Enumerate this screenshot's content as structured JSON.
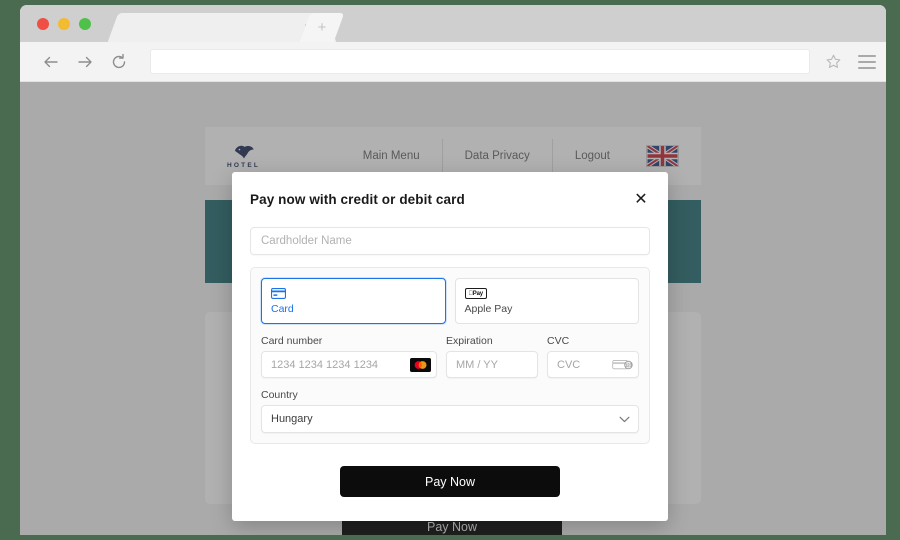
{
  "browser": {
    "tab_close_label": "×",
    "new_tab_label": "+",
    "address_value": "",
    "address_placeholder": "",
    "back_icon": "arrow-left-icon",
    "forward_icon": "arrow-right-icon",
    "reload_icon": "reload-icon",
    "bookmark_icon": "star-icon",
    "menu_icon": "hamburger-menu-icon"
  },
  "site": {
    "logo_text": "HOTEL",
    "nav": [
      {
        "label": "Main Menu"
      },
      {
        "label": "Data Privacy"
      },
      {
        "label": "Logout"
      }
    ],
    "language_flag": "uk-flag-icon",
    "background_pay_label": "Pay Now"
  },
  "modal": {
    "title": "Pay now with credit or debit card",
    "close_label": "✕",
    "cardholder": {
      "value": "",
      "placeholder": "Cardholder Name"
    },
    "methods": [
      {
        "label": "Card",
        "icon": "credit-card-icon",
        "selected": true
      },
      {
        "label": "Apple Pay",
        "icon": "apple-pay-icon",
        "badge": "Pay",
        "selected": false
      }
    ],
    "card_number": {
      "label": "Card number",
      "value": "",
      "placeholder": "1234 1234 1234 1234",
      "brand_icon": "mastercard-icon"
    },
    "expiration": {
      "label": "Expiration",
      "value": "",
      "placeholder": "MM / YY"
    },
    "cvc": {
      "label": "CVC",
      "value": "",
      "placeholder": "CVC",
      "hint_icon": "cvc-card-icon"
    },
    "country": {
      "label": "Country",
      "value": "Hungary",
      "options": [
        "Hungary"
      ],
      "chevron_icon": "chevron-down-icon"
    },
    "pay_label": "Pay Now"
  },
  "colors": {
    "accent_blue": "#1a73e8",
    "hero_teal": "#2e7479",
    "pay_button": "#0c0c0c",
    "logo_navy": "#2b3a5e"
  }
}
